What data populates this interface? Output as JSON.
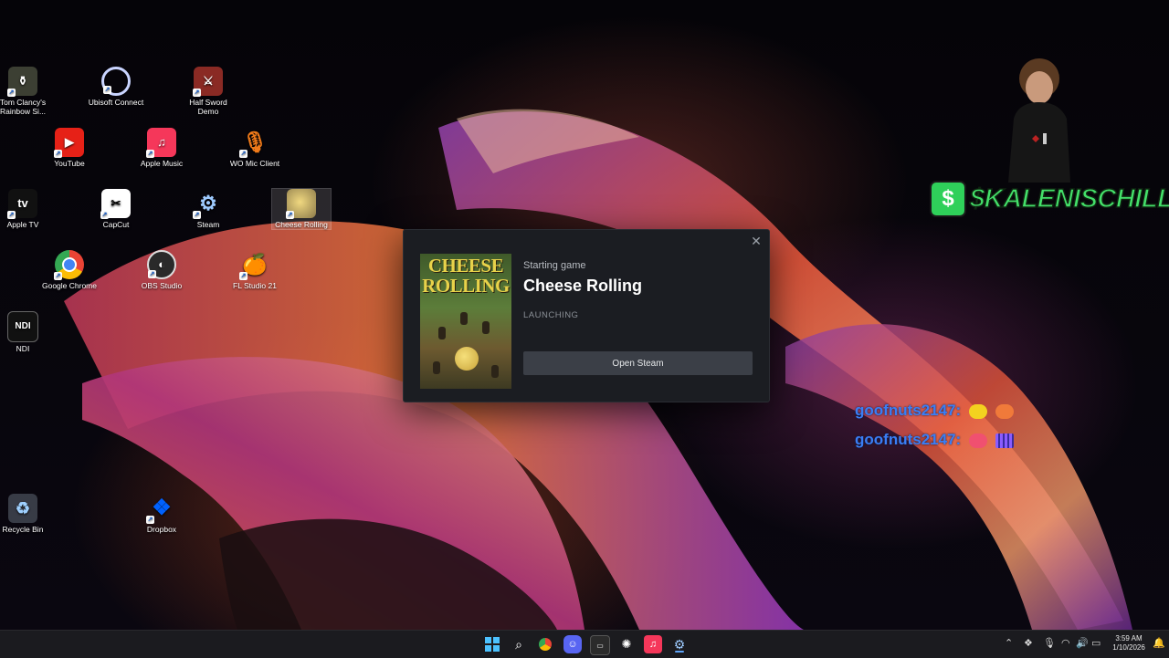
{
  "desktop_icons": [
    {
      "label": "Tom Clancy's Rainbow Si...",
      "icon": "rainbow-six-icon"
    },
    {
      "label": "Ubisoft Connect",
      "icon": "ubisoft-icon"
    },
    {
      "label": "Half Sword Demo",
      "icon": "half-sword-icon"
    },
    {
      "label": "YouTube",
      "icon": "youtube-icon"
    },
    {
      "label": "Apple Music",
      "icon": "apple-music-icon"
    },
    {
      "label": "WO Mic Client",
      "icon": "microphone-icon"
    },
    {
      "label": "Apple TV",
      "icon": "apple-tv-icon"
    },
    {
      "label": "CapCut",
      "icon": "capcut-icon"
    },
    {
      "label": "Steam",
      "icon": "steam-icon"
    },
    {
      "label": "Cheese Rolling",
      "icon": "cheese-rolling-icon"
    },
    {
      "label": "Google Chrome",
      "icon": "chrome-icon"
    },
    {
      "label": "OBS Studio",
      "icon": "obs-icon"
    },
    {
      "label": "FL Studio 21",
      "icon": "fl-studio-icon"
    },
    {
      "label": "NDI",
      "icon": "ndi-icon"
    },
    {
      "label": "Recycle Bin",
      "icon": "recycle-bin-icon"
    },
    {
      "label": "Dropbox",
      "icon": "dropbox-icon"
    }
  ],
  "dialog": {
    "subtitle": "Starting game",
    "title": "Cheese Rolling",
    "status": "LAUNCHING",
    "button": "Open Steam",
    "close_glyph": "✕",
    "cover_text": "CHEESE ROLLING"
  },
  "overlay": {
    "handle_symbol": "$",
    "handle": "$KALENISCHILL",
    "chat": [
      {
        "user": "goofnuts2147:"
      },
      {
        "user": "goofnuts2147:"
      }
    ]
  },
  "taskbar": {
    "apps": [
      "windows-start-icon",
      "search-icon",
      "chrome-icon",
      "discord-icon",
      "terminal-icon",
      "chatgpt-icon",
      "apple-music-icon",
      "steam-icon"
    ],
    "time": "3:59 AM",
    "date": "1/10/2026"
  },
  "colors": {
    "dialog_bg": "#1b1d22",
    "button_bg": "#3b3f47",
    "handle_green": "#44e06a",
    "chat_blue": "#3a7ef5"
  }
}
